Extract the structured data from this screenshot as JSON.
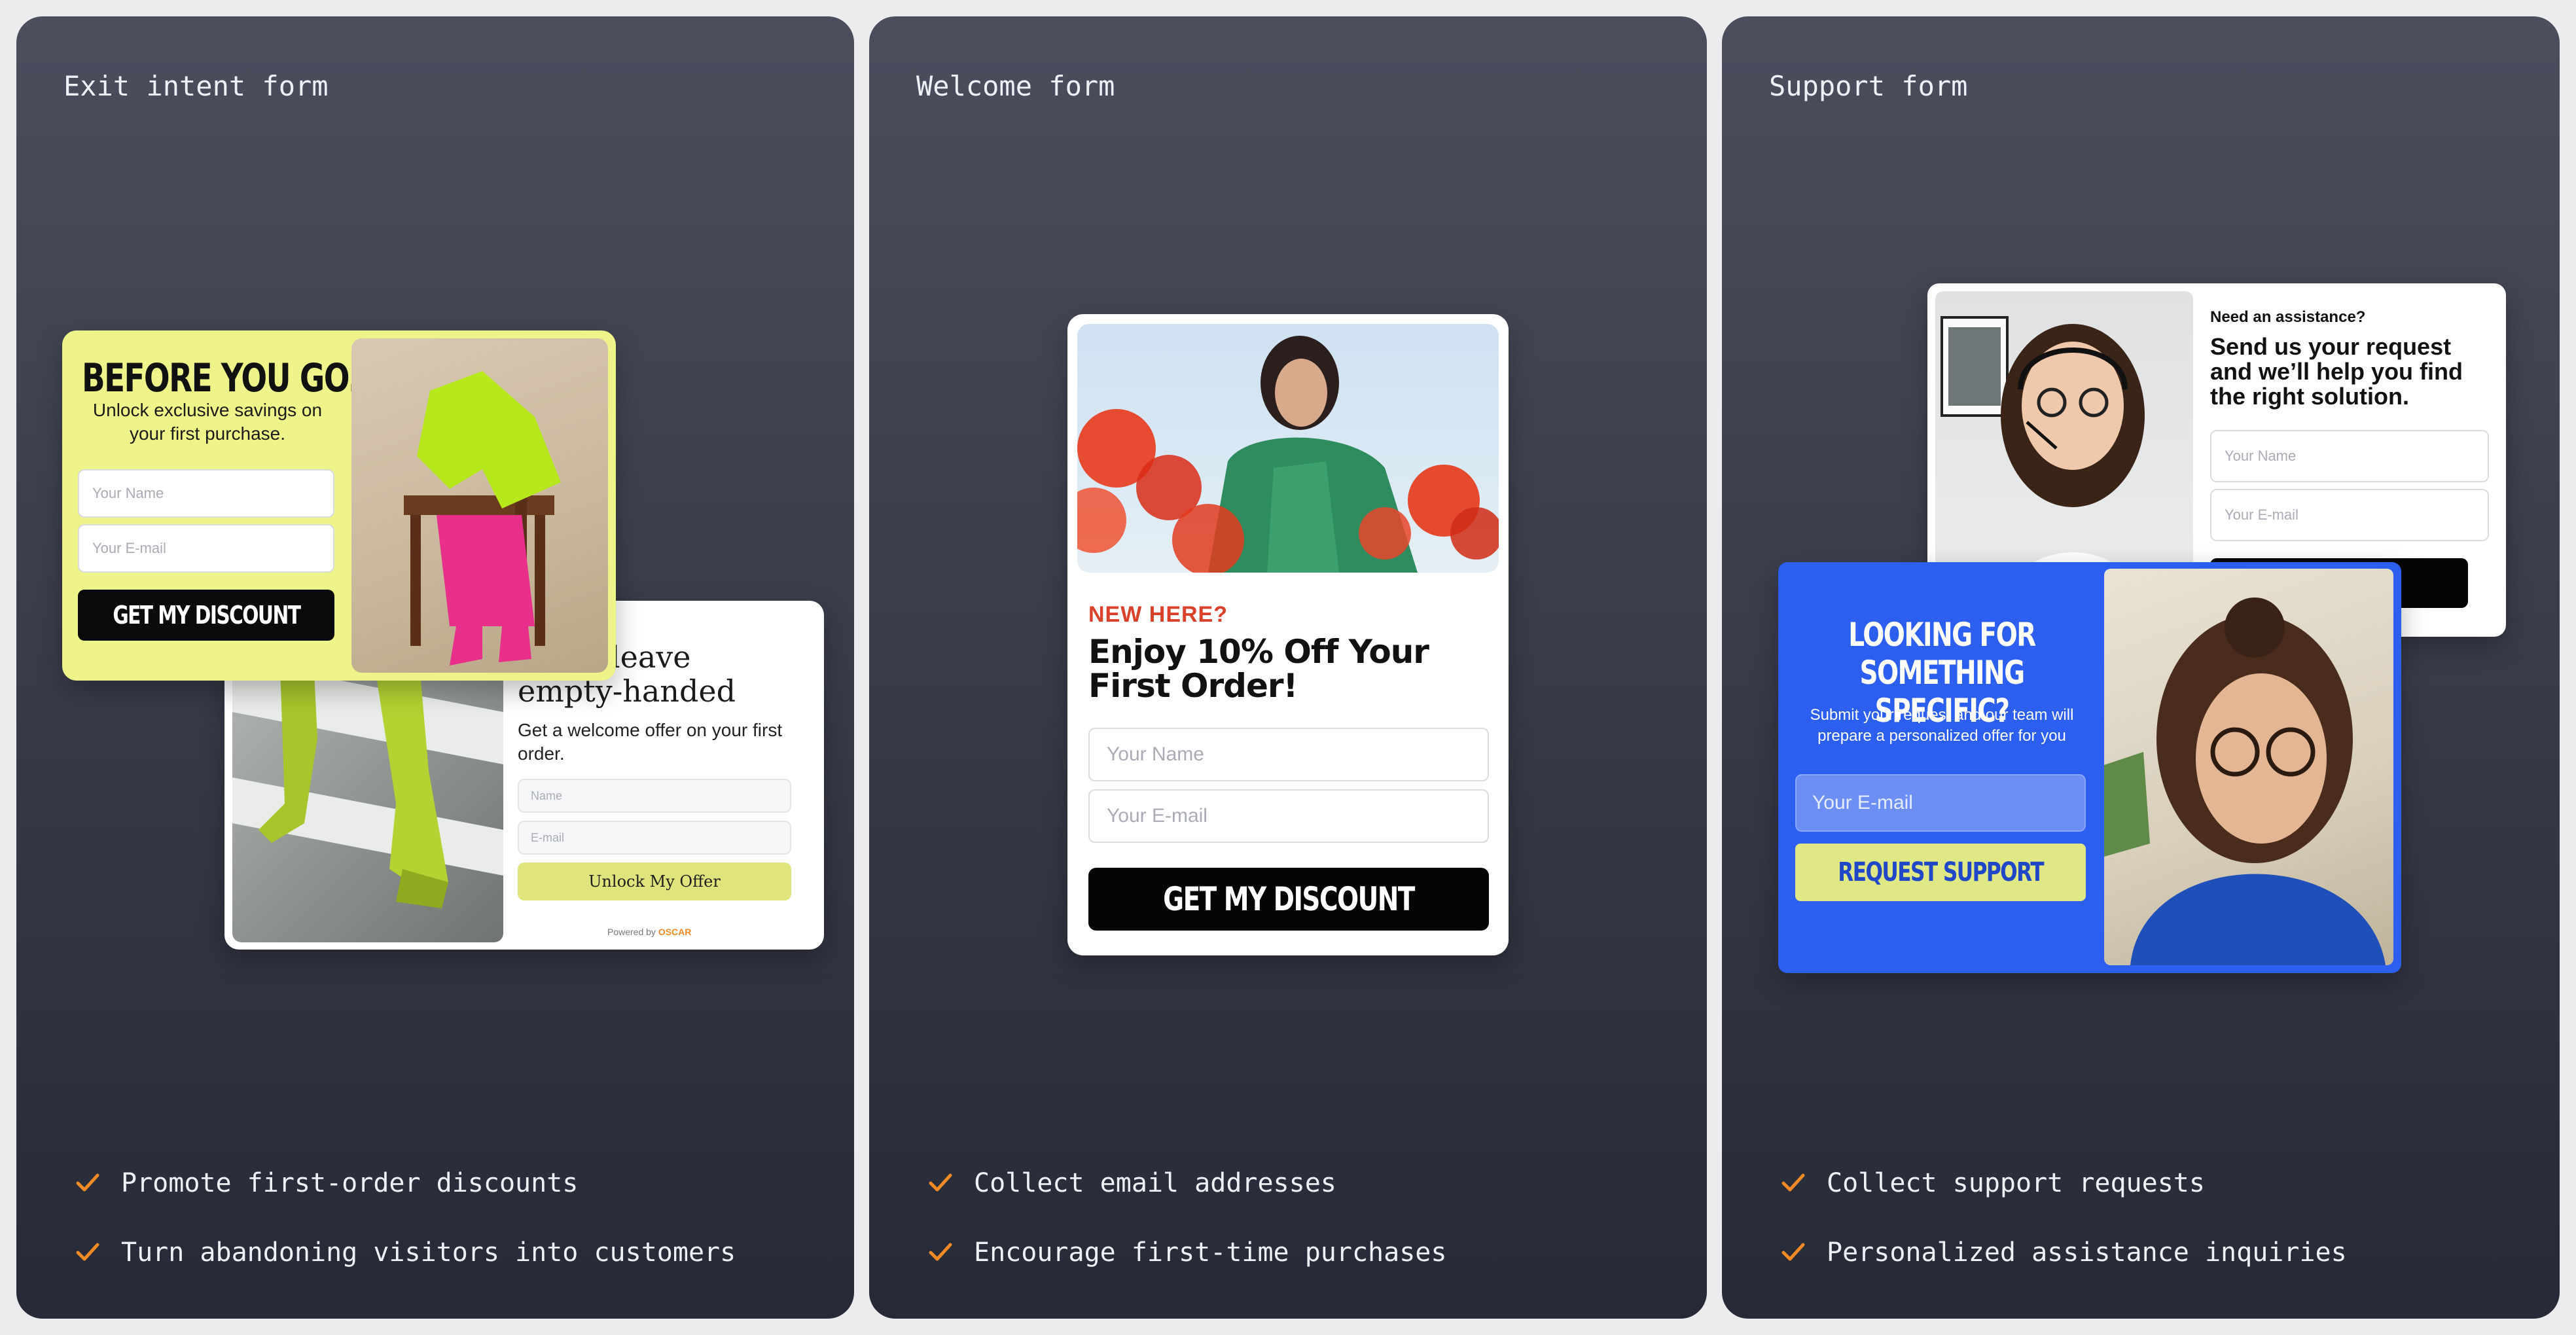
{
  "panels": [
    {
      "title": "Exit intent form",
      "features": [
        "Promote first-order discounts",
        "Turn abandoning visitors into customers"
      ],
      "form_front": {
        "headline": "BEFORE YOU GO...",
        "subtitle": "Unlock exclusive savings on your first purchase.",
        "name_placeholder": "Your Name",
        "email_placeholder": "Your E-mail",
        "button": "GET MY DISCOUNT"
      },
      "form_back": {
        "headline": "Don’t leave empty-handed",
        "subtitle": "Get a welcome offer on your first order.",
        "name_placeholder": "Name",
        "email_placeholder": "E-mail",
        "button": "Unlock My Offer",
        "powered_by": "Powered by",
        "brand": "OSCAR"
      }
    },
    {
      "title": "Welcome form",
      "features": [
        "Collect email addresses",
        "Encourage first-time purchases"
      ],
      "form": {
        "kicker": "NEW HERE?",
        "headline": "Enjoy 10% Off Your First Order!",
        "name_placeholder": "Your Name",
        "email_placeholder": "Your E-mail",
        "button": "GET MY DISCOUNT"
      }
    },
    {
      "title": "Support form",
      "features": [
        "Collect support requests",
        "Personalized assistance inquiries"
      ],
      "form_back": {
        "kicker": "Need an assistance?",
        "headline": "Send us your request and we’ll help you find the right solution.",
        "name_placeholder": "Your Name",
        "email_placeholder": "Your E-mail"
      },
      "form_front": {
        "headline": "LOOKING FOR SOMETHING SPECIFIC?",
        "subtitle": "Submit your request and our team will prepare a personalized offer for you",
        "email_placeholder": "Your E-mail",
        "button": "REQUEST SUPPORT"
      }
    }
  ],
  "colors": {
    "check": "#f08a24",
    "lime_card": "#eef48a",
    "support_blue": "#2c5ef0",
    "support_button": "#dfe884",
    "kicker_red": "#d9412b"
  }
}
